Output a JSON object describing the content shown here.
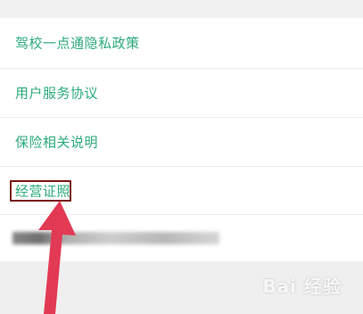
{
  "menu": {
    "items": [
      {
        "label": "驾校一点通隐私政策"
      },
      {
        "label": "用户服务协议"
      },
      {
        "label": "保险相关说明"
      },
      {
        "label": "经营证照"
      }
    ]
  },
  "colors": {
    "link_text": "#2bab7a",
    "highlight_border": "#7a1616",
    "arrow": "#e23a55"
  },
  "icons": {
    "annotation_arrow": "arrow-up-icon"
  },
  "watermark": {
    "text": "Bai 经验"
  }
}
